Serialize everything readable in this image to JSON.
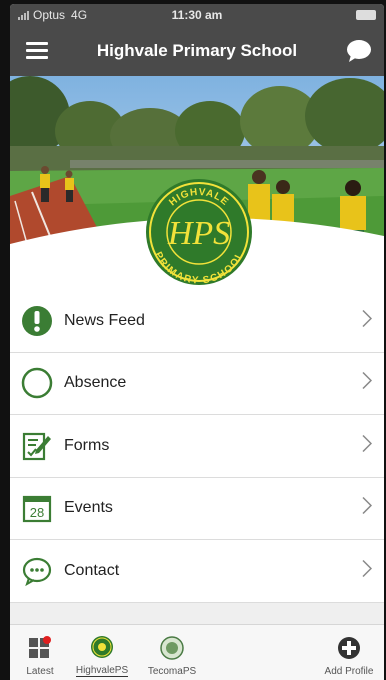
{
  "status_bar": {
    "carrier": "Optus",
    "network": "4G",
    "time": "11:30 am"
  },
  "header": {
    "title": "Highvale Primary School"
  },
  "logo": {
    "top_text": "HIGHVALE",
    "initials": "HPS",
    "bottom_text": "PRIMARY SCHOOL"
  },
  "menu": {
    "items": [
      {
        "label": "News Feed",
        "icon": "exclamation-icon"
      },
      {
        "label": "Absence",
        "icon": "circle-icon"
      },
      {
        "label": "Forms",
        "icon": "form-edit-icon"
      },
      {
        "label": "Events",
        "icon": "calendar-icon",
        "icon_text": "28"
      },
      {
        "label": "Contact",
        "icon": "chat-bubble-icon"
      }
    ]
  },
  "tabs": [
    {
      "label": "Latest",
      "icon": "grid-notification-icon"
    },
    {
      "label": "HighvalePS",
      "icon": "school-badge-icon",
      "active": true
    },
    {
      "label": "TecomaPS",
      "icon": "school-badge-icon"
    },
    {
      "label": "Add Profile",
      "icon": "add-circle-icon"
    }
  ],
  "colors": {
    "header_bg": "#4a4a4a",
    "accent_green": "#3b7d34",
    "logo_yellow": "#f2e23a",
    "logo_green": "#2f7a2a"
  }
}
